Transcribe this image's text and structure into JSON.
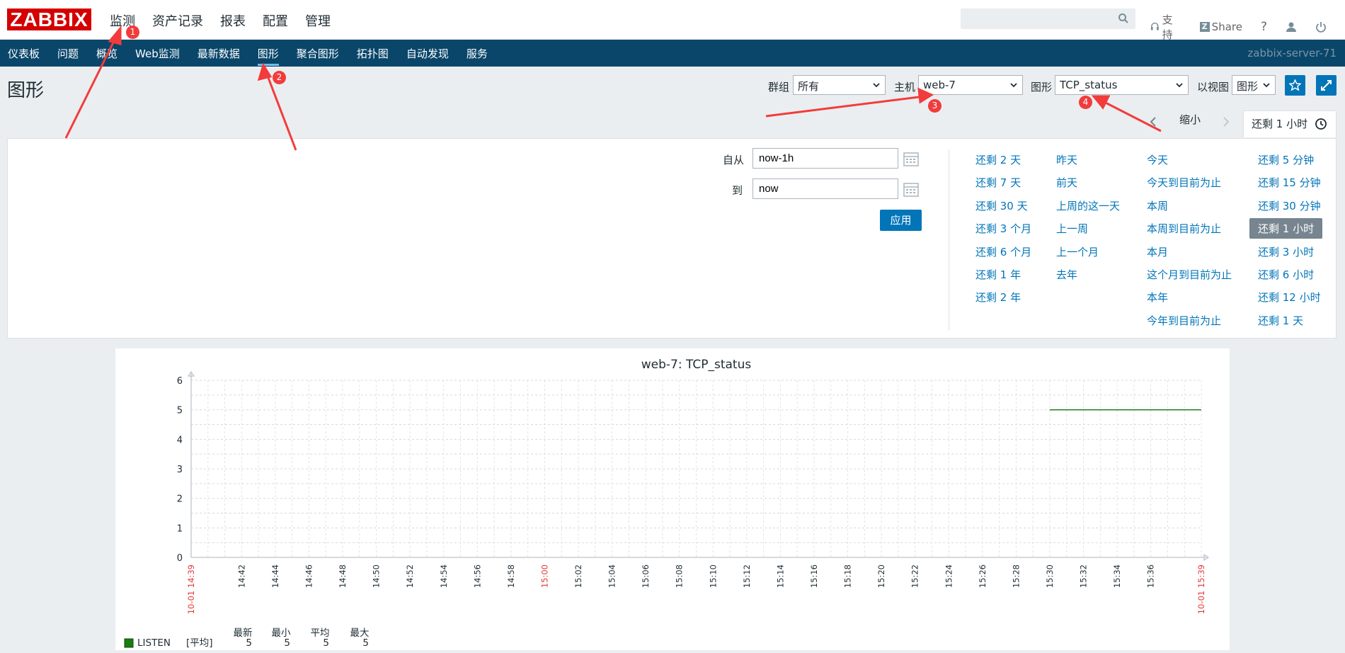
{
  "header": {
    "logo": "ZABBIX",
    "menu": [
      "监测",
      "资产记录",
      "报表",
      "配置",
      "管理"
    ],
    "links": {
      "support": "支持",
      "share": "Share",
      "help": "?"
    }
  },
  "submenu": {
    "items": [
      "仪表板",
      "问题",
      "概览",
      "Web监测",
      "最新数据",
      "图形",
      "聚合图形",
      "拓扑图",
      "自动发现",
      "服务"
    ],
    "active": "图形",
    "server_name": "zabbix-server-71"
  },
  "page": {
    "title": "图形",
    "filters": {
      "group_label": "群组",
      "group_value": "所有",
      "host_label": "主机",
      "host_value": "web-7",
      "graph_label": "图形",
      "graph_value": "TCP_status",
      "view_label": "以视图",
      "view_value": "图形"
    }
  },
  "timebar": {
    "zoom_out": "缩小",
    "active_range": "还剩 1 小时"
  },
  "timefilter": {
    "from_label": "自从",
    "from_value": "now-1h",
    "to_label": "到",
    "to_value": "now",
    "apply": "应用",
    "quick": [
      [
        "还剩 2 天",
        "还剩 7 天",
        "还剩 30 天",
        "还剩 3 个月",
        "还剩 6 个月",
        "还剩 1 年",
        "还剩 2 年"
      ],
      [
        "昨天",
        "前天",
        "上周的这一天",
        "上一周",
        "上一个月",
        "去年"
      ],
      [
        "今天",
        "今天到目前为止",
        "本周",
        "本周到目前为止",
        "本月",
        "这个月到目前为止",
        "本年",
        "今年到目前为止"
      ],
      [
        "还剩 5 分钟",
        "还剩 15 分钟",
        "还剩 30 分钟",
        "还剩 1 小时",
        "还剩 3 小时",
        "还剩 6 小时",
        "还剩 12 小时",
        "还剩 1 天"
      ]
    ],
    "selected": "还剩 1 小时"
  },
  "annotations": [
    "1",
    "2",
    "3",
    "4"
  ],
  "chart_data": {
    "type": "line",
    "title": "web-7: TCP_status",
    "ylim": [
      0,
      6
    ],
    "yticks": [
      "0",
      "1",
      "2",
      "3",
      "4",
      "5",
      "6"
    ],
    "x_start_label": "10-01 14:39",
    "x_end_label": "10-01 15:39",
    "xticks": [
      "14:42",
      "14:44",
      "14:46",
      "14:48",
      "14:50",
      "14:52",
      "14:54",
      "14:56",
      "14:58",
      "15:00",
      "15:02",
      "15:04",
      "15:06",
      "15:08",
      "15:10",
      "15:12",
      "15:14",
      "15:16",
      "15:18",
      "15:20",
      "15:22",
      "15:24",
      "15:26",
      "15:28",
      "15:30",
      "15:32",
      "15:34",
      "15:36"
    ],
    "grid": true,
    "series": [
      {
        "name": "LISTEN",
        "agg": "[平均]",
        "color": "#1a7c11",
        "x": [
          "15:30",
          "15:39"
        ],
        "values": [
          5,
          5
        ],
        "stats": {
          "last": "5",
          "min": "5",
          "avg": "5",
          "max": "5"
        }
      }
    ],
    "legend_headers": [
      "最新",
      "最小",
      "平均",
      "最大"
    ]
  }
}
